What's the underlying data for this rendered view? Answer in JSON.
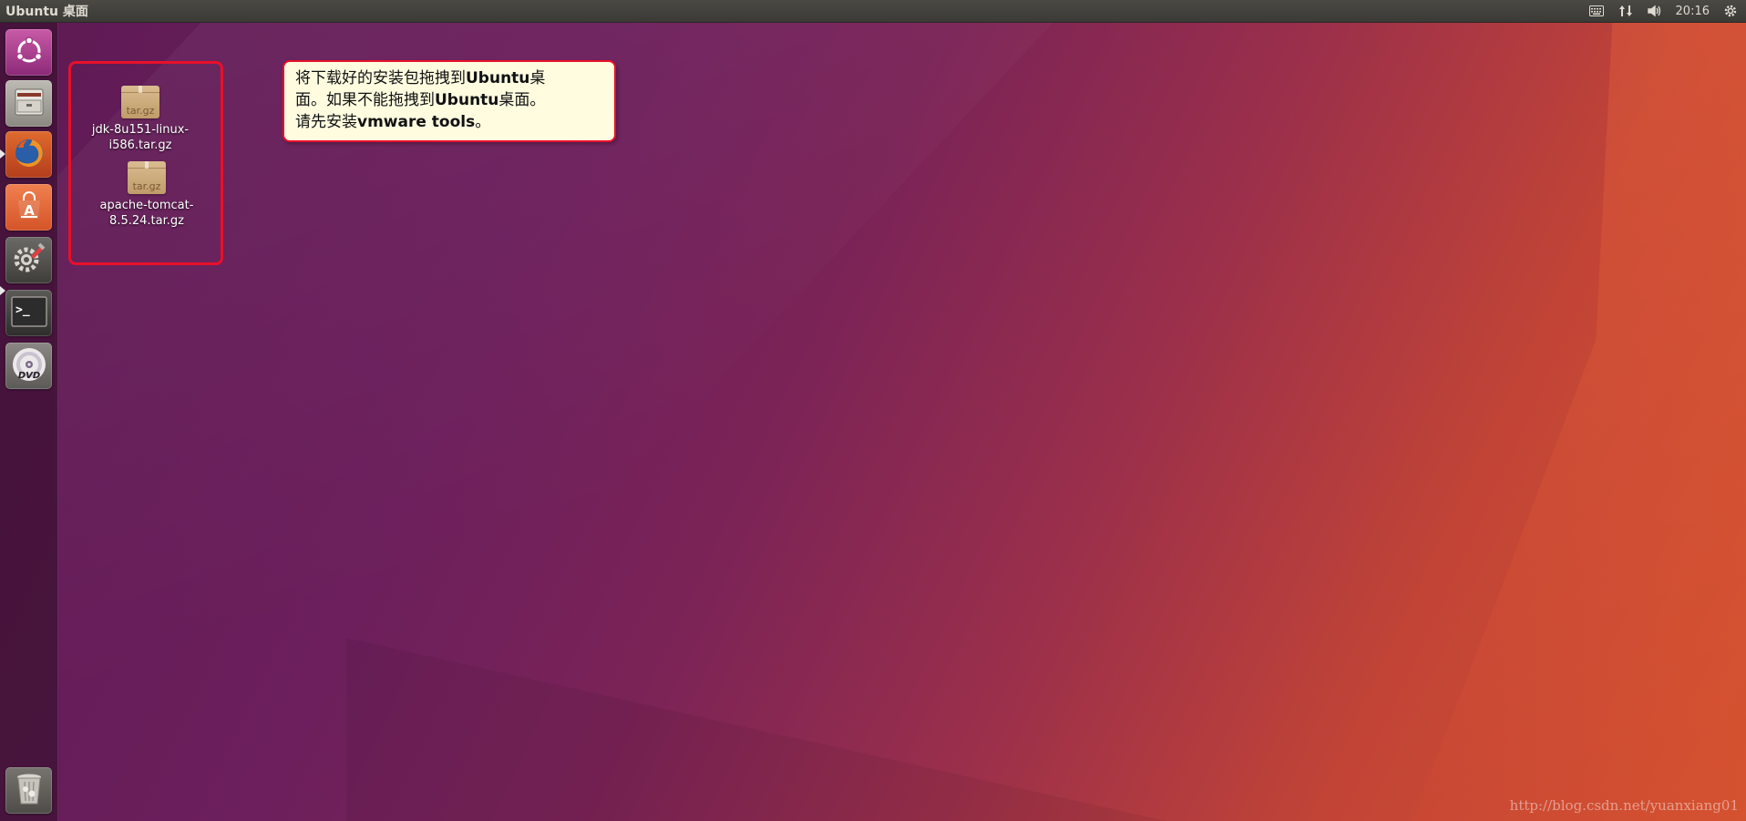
{
  "top_panel": {
    "title": "Ubuntu 桌面",
    "clock": "20:16",
    "tray_icons": [
      "keyboard-icon",
      "network-icon",
      "volume-icon",
      "gear-icon"
    ]
  },
  "launcher": {
    "items": [
      {
        "name": "dash",
        "icon": "ubuntu-logo-icon",
        "running": false
      },
      {
        "name": "files",
        "icon": "file-cabinet-icon",
        "running": false
      },
      {
        "name": "firefox",
        "icon": "firefox-icon",
        "running": true
      },
      {
        "name": "software-center",
        "icon": "software-bag-icon",
        "running": false
      },
      {
        "name": "system-settings",
        "icon": "settings-wrench-icon",
        "running": false
      },
      {
        "name": "terminal",
        "icon": "terminal-icon",
        "running": true
      },
      {
        "name": "dvd",
        "icon": "dvd-icon",
        "running": false
      },
      {
        "name": "trash",
        "icon": "trash-icon",
        "running": false
      }
    ],
    "terminal_prompt": ">_"
  },
  "desktop": {
    "files": [
      {
        "line1": "jdk-8u151-linux-",
        "line2": "i586.tar.gz",
        "badge": "tar.gz"
      },
      {
        "line1": "apache-tomcat-",
        "line2": "8.5.24.tar.gz",
        "badge": "tar.gz"
      }
    ]
  },
  "callout": {
    "l1a": "将下载好的安装包拖拽到",
    "l1b": "Ubuntu",
    "l1c": "桌",
    "l2a": "面。如果不能拖拽到",
    "l2b": "Ubuntu",
    "l2c": "桌面。",
    "l3a": "请先安装",
    "l3b": "vmware tools",
    "l3c": "。"
  },
  "watermark": "http://blog.csdn.net/yuanxiang01",
  "colors": {
    "highlight_border": "#e8102a",
    "callout_bg": "#fffce0"
  }
}
